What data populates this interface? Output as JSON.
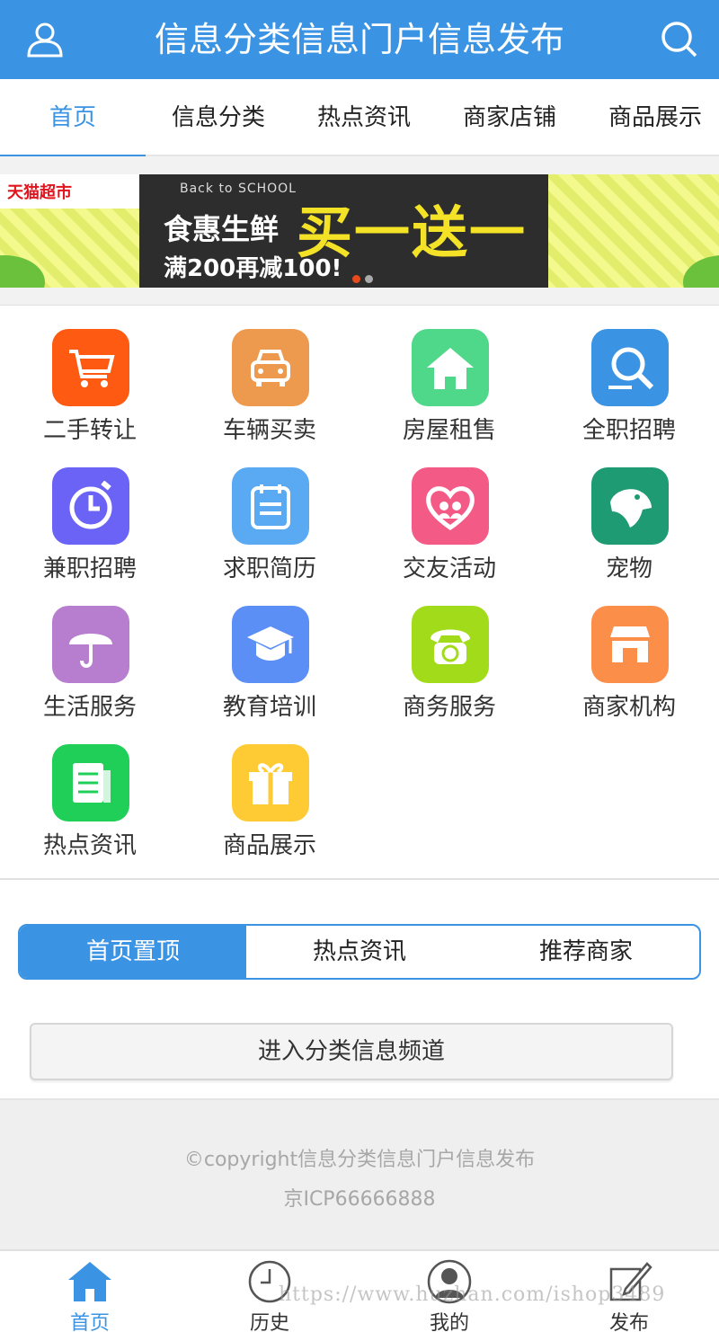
{
  "header": {
    "title": "信息分类信息门户信息发布",
    "user_icon": "user-icon",
    "search_icon": "search-icon",
    "bg_color": "#3b93e3"
  },
  "tabs": [
    {
      "label": "首页",
      "active": true
    },
    {
      "label": "信息分类",
      "active": false
    },
    {
      "label": "热点资讯",
      "active": false
    },
    {
      "label": "商家店铺",
      "active": false
    },
    {
      "label": "商品展示",
      "active": false
    }
  ],
  "banner": {
    "store_logo": "天猫超市",
    "tagline": "Back to SCHOOL",
    "headline_left": "食惠生鲜",
    "headline_right": "买一送一",
    "subline": "满200再减100!",
    "active_slide": 1,
    "slide_count": 2
  },
  "categories": [
    {
      "label": "二手转让",
      "icon": "cart-icon",
      "color": "#ff5a12"
    },
    {
      "label": "车辆买卖",
      "icon": "car-icon",
      "color": "#ee9a4e"
    },
    {
      "label": "房屋租售",
      "icon": "house-icon",
      "color": "#4fd88a"
    },
    {
      "label": "全职招聘",
      "icon": "magnifier-icon",
      "color": "#3b93e3"
    },
    {
      "label": "兼职招聘",
      "icon": "stopwatch-icon",
      "color": "#6b63f5"
    },
    {
      "label": "求职简历",
      "icon": "calendar-doc-icon",
      "color": "#5aa9f3"
    },
    {
      "label": "交友活动",
      "icon": "heart-couple-icon",
      "color": "#f35a86"
    },
    {
      "label": "宠物",
      "icon": "dog-icon",
      "color": "#1f9b74"
    },
    {
      "label": "生活服务",
      "icon": "umbrella-icon",
      "color": "#b77dcf"
    },
    {
      "label": "教育培训",
      "icon": "graduation-cap-icon",
      "color": "#5b8ff5"
    },
    {
      "label": "商务服务",
      "icon": "telephone-icon",
      "color": "#a2db1a"
    },
    {
      "label": "商家机构",
      "icon": "storefront-icon",
      "color": "#fb8f4a"
    },
    {
      "label": "热点资讯",
      "icon": "newspaper-icon",
      "color": "#1fcf58"
    },
    {
      "label": "商品展示",
      "icon": "gift-icon",
      "color": "#ffcb34"
    }
  ],
  "segment": [
    {
      "label": "首页置顶",
      "active": true
    },
    {
      "label": "热点资讯",
      "active": false
    },
    {
      "label": "推荐商家",
      "active": false
    }
  ],
  "enter_button": "进入分类信息频道",
  "footer": {
    "copyright": "©copyright信息分类信息门户信息发布",
    "icp": "京ICP66666888"
  },
  "bottom_nav": [
    {
      "label": "首页",
      "icon": "home-icon",
      "active": true
    },
    {
      "label": "历史",
      "icon": "clock-icon",
      "active": false
    },
    {
      "label": "我的",
      "icon": "profile-icon",
      "active": false
    },
    {
      "label": "发布",
      "icon": "edit-icon",
      "active": false
    }
  ],
  "watermark": "https://www.huzhan.com/ishop3489"
}
